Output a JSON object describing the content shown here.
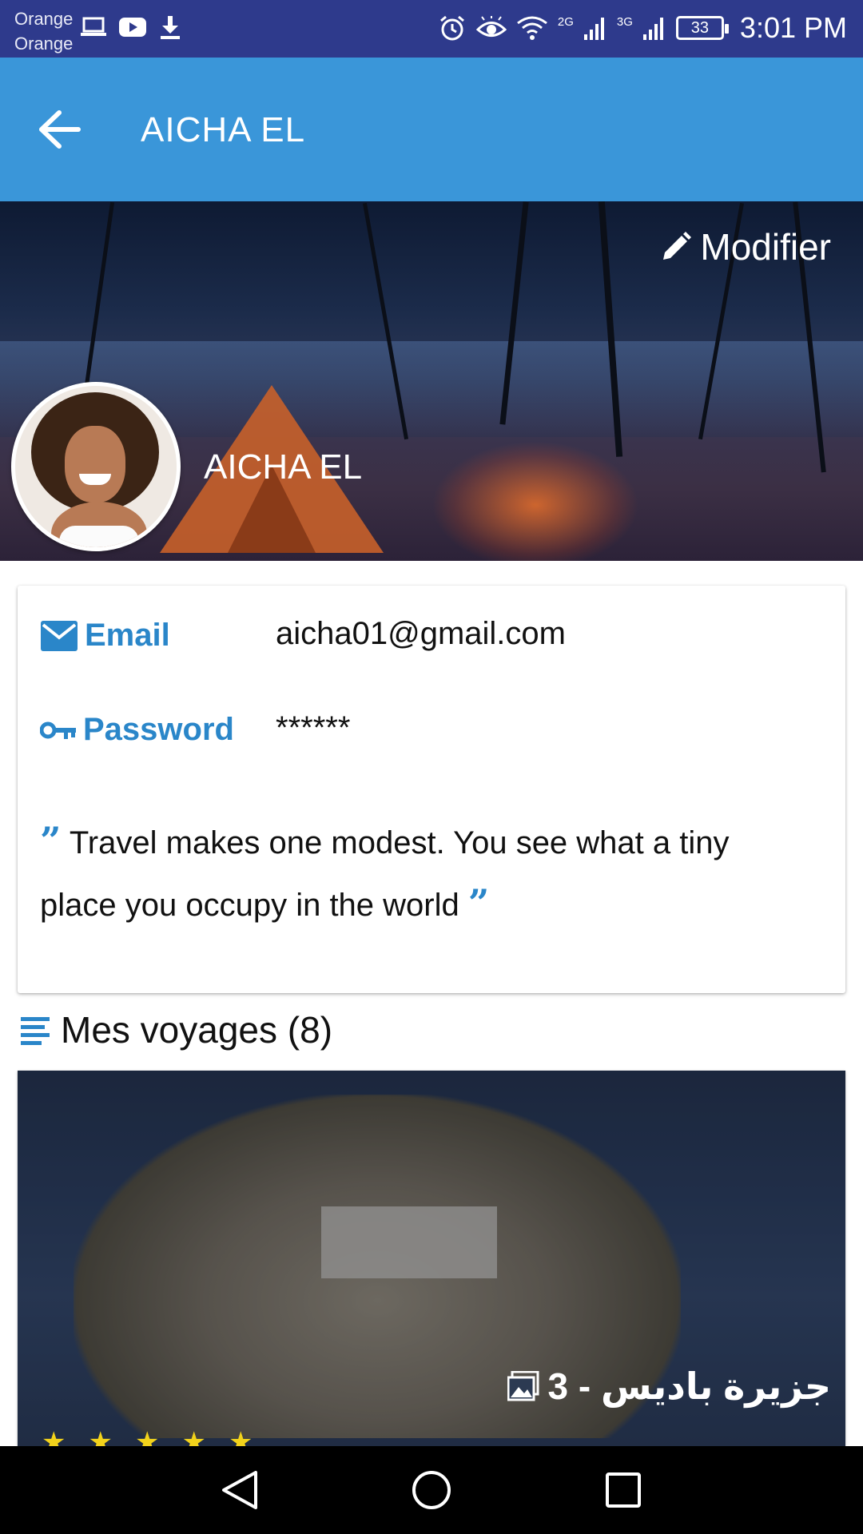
{
  "status_bar": {
    "carrier_1": "Orange",
    "carrier_2": "Orange",
    "signal_2g": "2G",
    "signal_3g": "3G",
    "battery": "33",
    "time": "3:01 PM"
  },
  "app_bar": {
    "title": "AICHA EL"
  },
  "cover": {
    "edit_label": "Modifier",
    "name": "AICHA EL"
  },
  "profile": {
    "email_label": "Email",
    "email_value": "aicha01@gmail.com",
    "password_label": "Password",
    "password_value": "******",
    "quote_text": "Travel makes one modest. You see what a tiny place you occupy in the world"
  },
  "trips": {
    "title": "Mes voyages (8)",
    "items": [
      {
        "caption": "جزيرة باديس - 3"
      }
    ]
  },
  "colors": {
    "status_bar": "#2e3a8c",
    "app_bar": "#3a96d9",
    "accent": "#2a86c9",
    "star": "#f2d21b"
  }
}
